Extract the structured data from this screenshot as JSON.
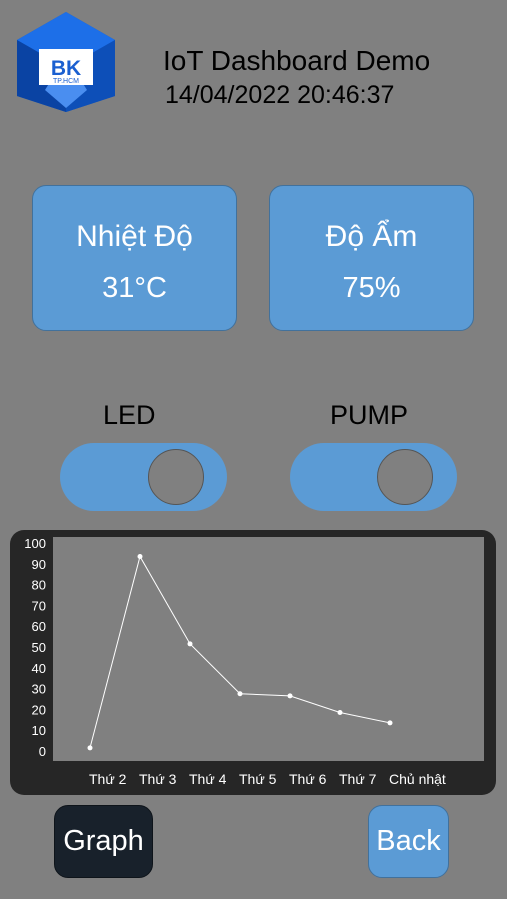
{
  "header": {
    "logo_text": "BK",
    "logo_subtext": "TP.HCM",
    "title": "IoT Dashboard Demo",
    "datetime": "14/04/2022 20:46:37"
  },
  "sensors": {
    "temperature": {
      "label": "Nhiệt Độ",
      "value": "31°C"
    },
    "humidity": {
      "label": "Độ Ẩm",
      "value": "75%"
    }
  },
  "controls": {
    "led": {
      "label": "LED",
      "state": "on"
    },
    "pump": {
      "label": "PUMP",
      "state": "on"
    }
  },
  "chart_data": {
    "type": "line",
    "categories": [
      "Thứ 2",
      "Thứ 3",
      "Thứ 4",
      "Thứ 5",
      "Thứ 6",
      "Thứ 7",
      "Chủ nhật"
    ],
    "values": [
      2,
      94,
      52,
      28,
      27,
      19,
      14
    ],
    "ylim": [
      0,
      100
    ],
    "yticks": [
      0,
      10,
      20,
      30,
      40,
      50,
      60,
      70,
      80,
      90,
      100
    ],
    "title": "",
    "xlabel": "",
    "ylabel": "",
    "line_color": "#ffffff",
    "plot_bg": "#808080",
    "panel_bg": "#262626"
  },
  "buttons": {
    "graph": "Graph",
    "back": "Back"
  },
  "colors": {
    "accent": "#5b9bd5",
    "background": "#808080",
    "dark_button": "#18212b"
  }
}
